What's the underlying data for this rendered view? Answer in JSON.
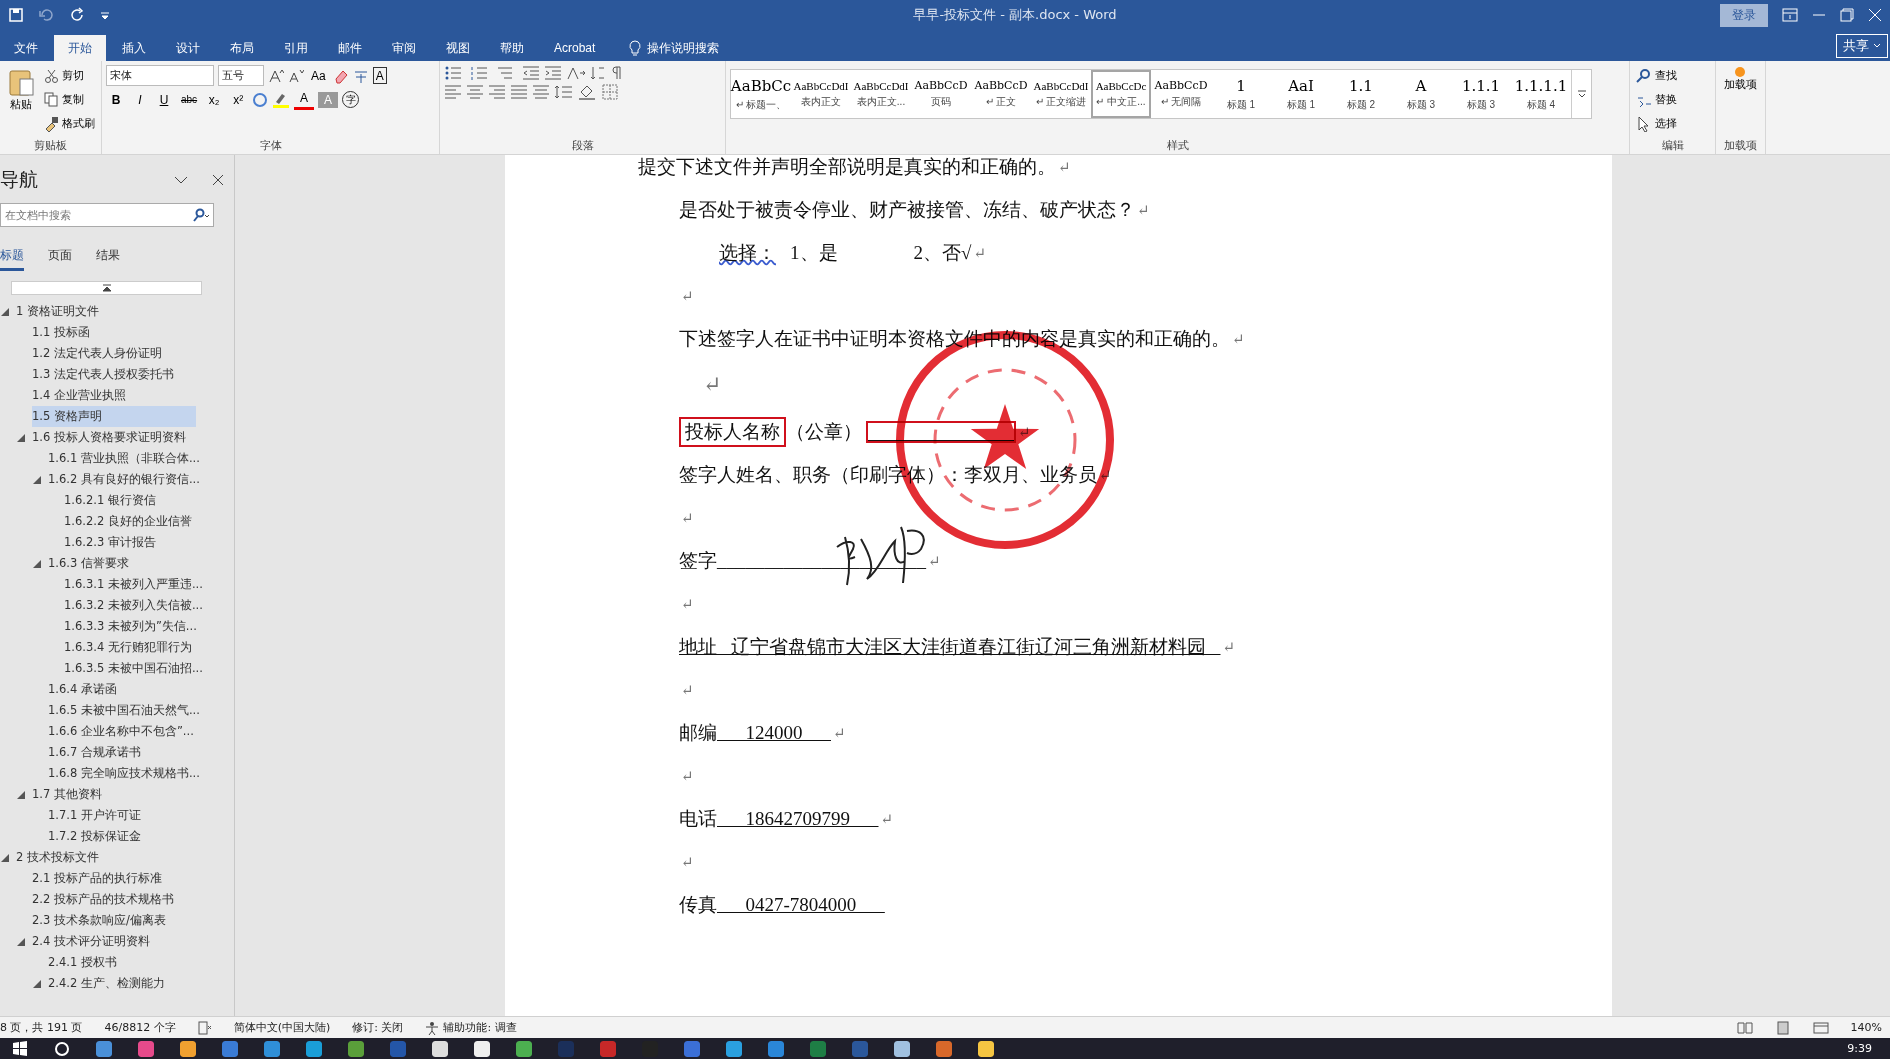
{
  "window": {
    "title": "早早-投标文件 - 副本.docx  -  Word",
    "login": "登录",
    "share": "共享"
  },
  "ribbon_tabs": [
    {
      "label": "文件",
      "selected": false
    },
    {
      "label": "开始",
      "selected": true
    },
    {
      "label": "插入",
      "selected": false
    },
    {
      "label": "设计",
      "selected": false
    },
    {
      "label": "布局",
      "selected": false
    },
    {
      "label": "引用",
      "selected": false
    },
    {
      "label": "邮件",
      "selected": false
    },
    {
      "label": "审阅",
      "selected": false
    },
    {
      "label": "视图",
      "selected": false
    },
    {
      "label": "帮助",
      "selected": false
    },
    {
      "label": "Acrobat",
      "selected": false
    }
  ],
  "tell_me": "操作说明搜索",
  "clipboard": {
    "paste": "粘贴",
    "items": [
      "剪切",
      "复制",
      "格式刷"
    ],
    "group": "剪贴板"
  },
  "font": {
    "name": "宋体",
    "size": "五号",
    "case_glyph": "Aa",
    "border_glyph": "A",
    "format_glyphs": [
      "B",
      "I",
      "U",
      "abc",
      "x₂",
      "x²"
    ],
    "color_glyph": "A",
    "shade_glyph": "A",
    "enclose_glyph": "字",
    "group": "字体"
  },
  "paragraph": {
    "group": "段落"
  },
  "styles": {
    "group": "样式",
    "items": [
      {
        "preview": "AaBbCc",
        "name": "标题一、",
        "prefix": "↵",
        "kind": "heading",
        "selected": false
      },
      {
        "preview": "AaBbCcDdI",
        "name": "表内正文",
        "kind": "mono",
        "selected": false
      },
      {
        "preview": "AaBbCcDdI",
        "name": "表内正文...",
        "kind": "mono",
        "selected": false
      },
      {
        "preview": "AaBbCcD",
        "name": "页码",
        "kind": "body",
        "selected": false
      },
      {
        "preview": "AaBbCcD",
        "name": "正文",
        "prefix": "↵",
        "kind": "body",
        "selected": false
      },
      {
        "preview": "AaBbCcDdI",
        "name": "正文缩进",
        "prefix": "↵",
        "kind": "mono",
        "selected": false
      },
      {
        "preview": "AaBbCcDc",
        "name": "中文正...",
        "prefix": "↵",
        "kind": "mono",
        "selected": true
      },
      {
        "preview": "AaBbCcD",
        "name": "无间隔",
        "prefix": "↵",
        "kind": "body",
        "selected": false
      },
      {
        "preview": "1",
        "name": "标题 1",
        "kind": "heading",
        "selected": false
      },
      {
        "preview": "AaI",
        "name": "标题 1",
        "kind": "heading",
        "selected": false
      },
      {
        "preview": "1.1",
        "name": "标题 2",
        "kind": "heading",
        "selected": false
      },
      {
        "preview": "A",
        "name": "标题 3",
        "kind": "heading",
        "selected": false
      },
      {
        "preview": "1.1.1",
        "name": "标题 3",
        "kind": "heading",
        "selected": false
      },
      {
        "preview": "1.1.1.1",
        "name": "标题 4",
        "kind": "heading",
        "selected": false
      }
    ]
  },
  "editing": {
    "items": [
      "查找",
      "替换",
      "选择"
    ],
    "group": "编辑"
  },
  "addins": {
    "button": "加载项",
    "group": "加载项"
  },
  "navigation": {
    "title": "导航",
    "placeholder": "在文档中搜索",
    "tabs": [
      {
        "label": "标题",
        "selected": true
      },
      {
        "label": "页面",
        "selected": false
      },
      {
        "label": "结果",
        "selected": false
      }
    ],
    "tree": [
      {
        "label": "1 资格证明文件",
        "expanded": true,
        "selected": false,
        "children": [
          {
            "label": "1.1 投标函",
            "selected": false
          },
          {
            "label": "1.2 法定代表人身份证明",
            "selected": false
          },
          {
            "label": "1.3 法定代表人授权委托书",
            "selected": false
          },
          {
            "label": "1.4 企业营业执照",
            "selected": false
          },
          {
            "label": "1.5 资格声明",
            "selected": true
          },
          {
            "label": "1.6 投标人资格要求证明资料",
            "expanded": true,
            "selected": false,
            "children": [
              {
                "label": "1.6.1 营业执照（非联合体...",
                "selected": false
              },
              {
                "label": "1.6.2 具有良好的银行资信...",
                "expanded": true,
                "selected": false,
                "children": [
                  {
                    "label": "1.6.2.1 银行资信",
                    "selected": false
                  },
                  {
                    "label": "1.6.2.2 良好的企业信誉",
                    "selected": false
                  },
                  {
                    "label": "1.6.2.3 审计报告",
                    "selected": false
                  }
                ]
              },
              {
                "label": "1.6.3 信誉要求",
                "expanded": true,
                "selected": false,
                "children": [
                  {
                    "label": "1.6.3.1 未被列入严重违...",
                    "selected": false
                  },
                  {
                    "label": "1.6.3.2 未被列入失信被...",
                    "selected": false
                  },
                  {
                    "label": "1.6.3.3 未被列为”失信...",
                    "selected": false
                  },
                  {
                    "label": "1.6.3.4 无行贿犯罪行为",
                    "selected": false
                  },
                  {
                    "label": "1.6.3.5 未被中国石油招...",
                    "selected": false
                  }
                ]
              },
              {
                "label": "1.6.4 承诺函",
                "selected": false
              },
              {
                "label": "1.6.5 未被中国石油天然气...",
                "selected": false
              },
              {
                "label": "1.6.6 企业名称中不包含”...",
                "selected": false
              },
              {
                "label": "1.6.7 合规承诺书",
                "selected": false
              },
              {
                "label": "1.6.8 完全响应技术规格书...",
                "selected": false
              }
            ]
          },
          {
            "label": "1.7 其他资料",
            "expanded": true,
            "selected": false,
            "children": [
              {
                "label": "1.7.1 开户许可证",
                "selected": false
              },
              {
                "label": "1.7.2 投标保证金",
                "selected": false
              }
            ]
          }
        ]
      },
      {
        "label": "2 技术投标文件",
        "expanded": true,
        "selected": false,
        "children": [
          {
            "label": "2.1 投标产品的执行标准",
            "selected": false
          },
          {
            "label": "2.2 投标产品的技术规格书",
            "selected": false
          },
          {
            "label": "2.3 技术条款响应/偏离表",
            "selected": false
          },
          {
            "label": "2.4 技术评分证明资料",
            "expanded": true,
            "selected": false,
            "children": [
              {
                "label": "2.4.1 授权书",
                "selected": false
              },
              {
                "label": "2.4.2 生产、检测能力",
                "expanded": true,
                "selected": false
              }
            ]
          }
        ]
      }
    ]
  },
  "document": {
    "paragraphs": [
      {
        "kind": "lead",
        "text": "提交下述文件并声明全部说明是真实的和正确的。",
        "mark": "↵"
      },
      {
        "kind": "body",
        "text": "是否处于被责令停业、财产被接管、冻结、破产状态？",
        "mark": "↵"
      },
      {
        "kind": "choice",
        "label": "选择：",
        "options": [
          "1、是",
          "2、否√"
        ],
        "mark": "↵"
      },
      {
        "kind": "empty",
        "mark": "↵"
      },
      {
        "kind": "body",
        "text": "下述签字人在证书中证明本资格文件中的内容是真实的和正确的。",
        "mark": "↵"
      },
      {
        "kind": "empty_large",
        "mark": "↵"
      },
      {
        "kind": "seal_line",
        "label": "投标人名称",
        "suffix": "（公章）",
        "mark": "↵"
      },
      {
        "kind": "body",
        "text": "签字人姓名、职务（印刷字体）：李双月、业务员",
        "mark": "↵"
      },
      {
        "kind": "empty",
        "mark": "↵"
      },
      {
        "kind": "signature",
        "label": "签字",
        "blank": "______________________",
        "mark": "↵"
      },
      {
        "kind": "empty",
        "mark": "↵"
      },
      {
        "kind": "underlined",
        "text": "地址   辽宁省盘锦市大洼区大洼街道春江街辽河三角洲新材料园   ",
        "mark": "↵"
      },
      {
        "kind": "empty",
        "mark": "↵"
      },
      {
        "kind": "fill",
        "label": "邮编",
        "value": "124000",
        "mark": "↵"
      },
      {
        "kind": "empty",
        "mark": "↵"
      },
      {
        "kind": "fill",
        "label": "电话",
        "value": "18642709799",
        "mark": "↵"
      },
      {
        "kind": "empty",
        "mark": "↵"
      },
      {
        "kind": "fill",
        "label": "传真",
        "value": "0427-7804000"
      }
    ]
  },
  "status_bar": {
    "left": [
      "8 页，共 191 页",
      "46/8812 个字"
    ],
    "language": "简体中文(中国大陆)",
    "track": "修订: 关闭",
    "accessibility": "辅助功能: 调查",
    "zoom": "140%"
  },
  "taskbar": {
    "time": "9:39"
  }
}
